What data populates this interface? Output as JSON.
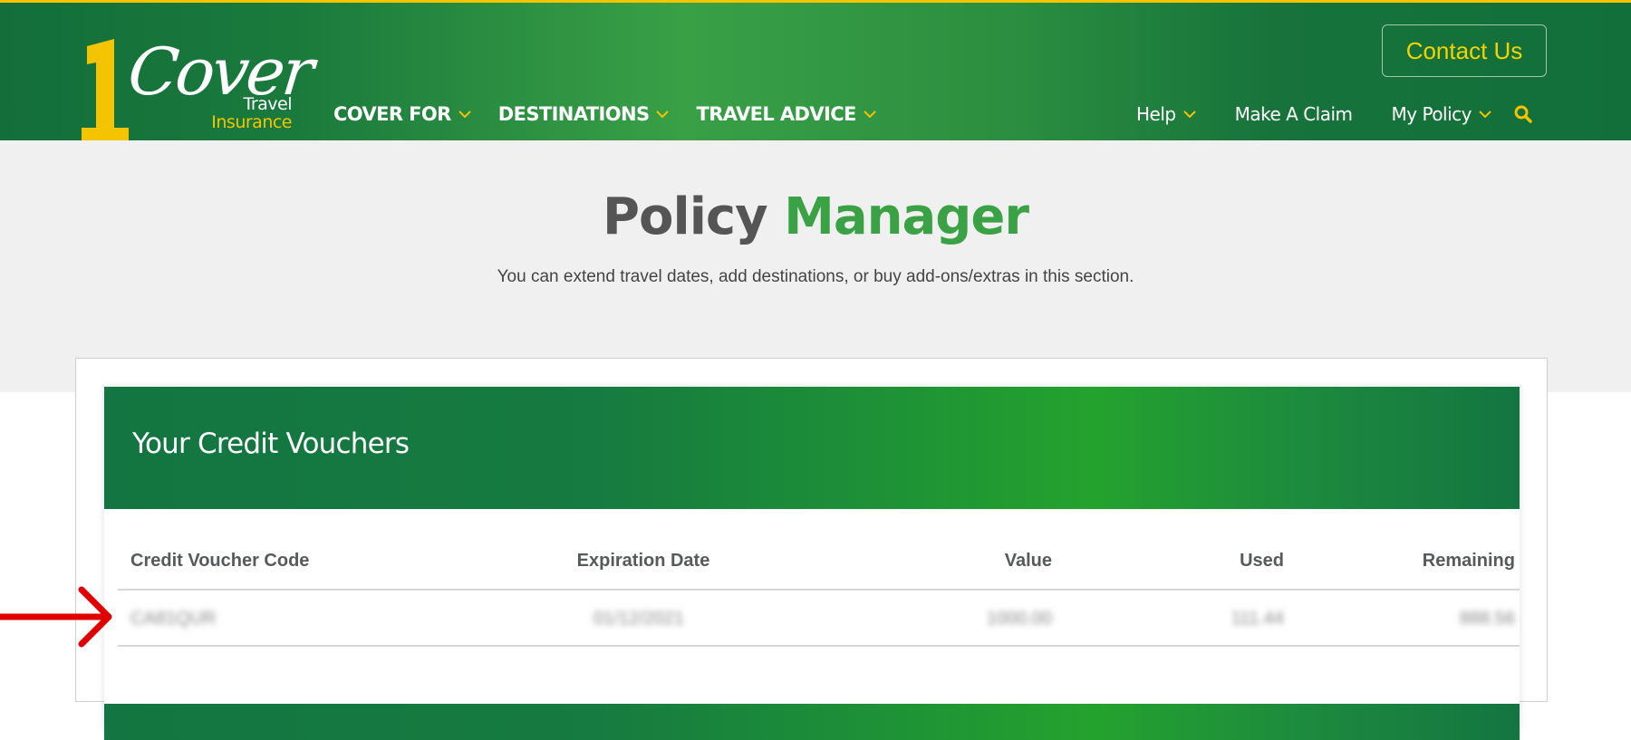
{
  "brand": {
    "logo_number": "1",
    "logo_script": "Cover",
    "logo_line1": "Travel",
    "logo_line2": "Insurance",
    "colors": {
      "primary_green": "#137541",
      "bright_green": "#3aa244",
      "yellow": "#f5c400",
      "annotation_red": "#e00000"
    }
  },
  "header": {
    "main_nav": [
      {
        "label": "COVER FOR",
        "icon": "chevron-down-icon"
      },
      {
        "label": "DESTINATIONS",
        "icon": "chevron-down-icon"
      },
      {
        "label": "TRAVEL ADVICE",
        "icon": "chevron-down-icon"
      }
    ],
    "contact_button": "Contact Us",
    "util_nav": [
      {
        "label": "Help",
        "icon": "chevron-down-icon"
      },
      {
        "label": "Make A Claim"
      },
      {
        "label": "My Policy",
        "icon": "chevron-down-icon"
      }
    ],
    "search_icon": "search-icon"
  },
  "hero": {
    "title_part1": "Policy",
    "title_part2": "Manager",
    "subtitle": "You can extend travel dates, add destinations, or buy add-ons/extras in this section."
  },
  "vouchers": {
    "title": "Your Credit Vouchers",
    "columns": [
      "Credit Voucher Code",
      "Expiration Date",
      "Value",
      "Used",
      "Remaining"
    ],
    "rows": [
      {
        "code": "CA81QUR",
        "expiration": "01/12/2021",
        "value": "1000.00",
        "used": "111.44",
        "remaining": "888.56",
        "redacted": true
      }
    ]
  },
  "annotation": {
    "type": "arrow",
    "points_to": "voucher-row"
  }
}
